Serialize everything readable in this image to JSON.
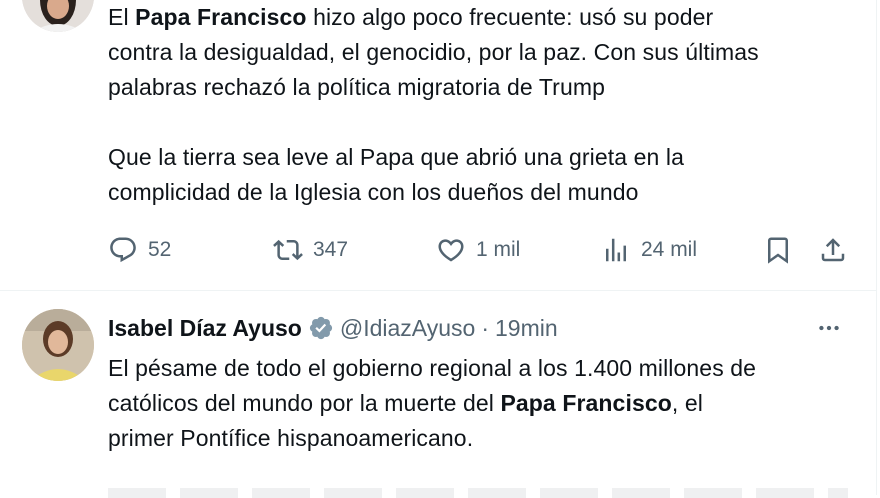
{
  "tweets": [
    {
      "text_paragraphs": [
        [
          "El ",
          {
            "bold": "Papa Francisco"
          },
          " hizo algo poco frecuente: usó su poder contra la desigualdad, el genocidio, por la paz. Con sus últimas palabras rechazó la política migratoria de Trump"
        ],
        [
          "Que la tierra sea leve al Papa que abrió una grieta en la complicidad de la Iglesia con los dueños del mundo"
        ]
      ],
      "lines": [
        {
          "pre": "El ",
          "bold": "Papa Francisco",
          "post": " hizo algo poco frecuente: usó su poder"
        },
        {
          "pre": "contra la desigualdad, el genocidio, por la paz. Con sus últimas"
        },
        {
          "pre": "palabras rechazó la política migratoria de Trump"
        },
        {
          "pre": ""
        },
        {
          "pre": "Que la tierra sea leve al Papa que abrió una grieta en la"
        },
        {
          "pre": "complicidad de la Iglesia con los dueños del mundo"
        }
      ],
      "actions": {
        "reply": "52",
        "retweet": "347",
        "like": "1 mil",
        "views": "24 mil"
      }
    },
    {
      "author_name": "Isabel Díaz Ayuso",
      "handle": "@IdiazAyuso",
      "separator": "·",
      "time": "19min",
      "lines": [
        {
          "pre": "El pésame de todo el gobierno regional a los 1.400 millones de"
        },
        {
          "pre": "católicos del mundo por la muerte del ",
          "bold": "Papa Francisco",
          "post": ", el"
        },
        {
          "pre": "primer Pontífice hispanoamericano."
        }
      ]
    }
  ],
  "colors": {
    "text": "#0f1419",
    "muted": "#536471",
    "verified": "#829aab",
    "divider": "#eff3f4"
  },
  "icons": [
    "reply-icon",
    "retweet-icon",
    "like-icon",
    "views-icon",
    "bookmark-icon",
    "share-icon",
    "verified-icon",
    "more-icon"
  ]
}
